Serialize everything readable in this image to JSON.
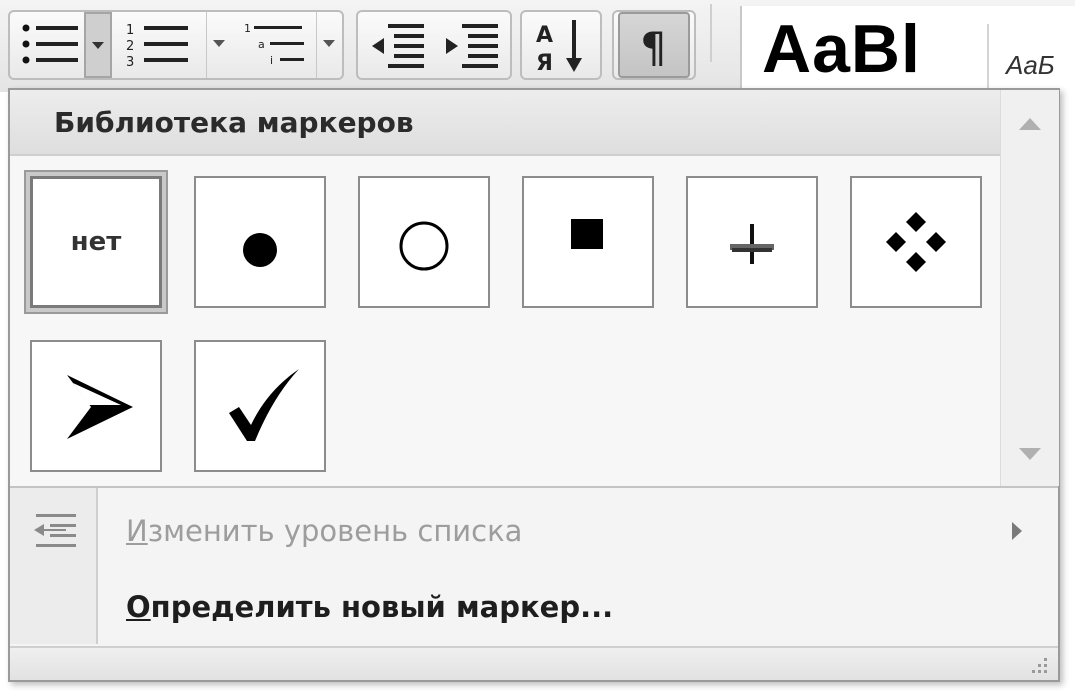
{
  "ribbon": {
    "groups": [
      {
        "name": "list-buttons",
        "buttons": [
          "bullets-icon",
          "numbering-icon",
          "multilevel-list-icon"
        ]
      },
      {
        "name": "indent-buttons",
        "buttons": [
          "decrease-indent-icon",
          "increase-indent-icon"
        ]
      },
      {
        "name": "sort",
        "buttons": [
          "sort-icon"
        ]
      },
      {
        "name": "marks",
        "buttons": [
          "pilcrow-icon"
        ]
      }
    ],
    "pilcrow": "¶",
    "sort_glyph_top": "А",
    "sort_glyph_bottom": "Я",
    "styles": {
      "big_sample": "AaBl",
      "small_sample": "AaБ"
    }
  },
  "bullet_library": {
    "title": "Библиотека маркеров",
    "none_label": "нет",
    "bullets": [
      {
        "name": "none",
        "selected": true
      },
      {
        "name": "filled-circle"
      },
      {
        "name": "hollow-circle"
      },
      {
        "name": "filled-square"
      },
      {
        "name": "cross"
      },
      {
        "name": "diamond-cluster"
      },
      {
        "name": "arrowhead"
      },
      {
        "name": "checkmark"
      }
    ]
  },
  "menu": {
    "change_level": {
      "underlined": "И",
      "rest": "зменить уровень списка",
      "enabled": false
    },
    "define_new": {
      "underlined": "О",
      "rest": "пределить новый маркер...",
      "enabled": true
    }
  },
  "colors": {
    "panel_bg": "#f4f4f4",
    "disabled_text": "#9d9d9d",
    "border": "#9a9a9a"
  }
}
